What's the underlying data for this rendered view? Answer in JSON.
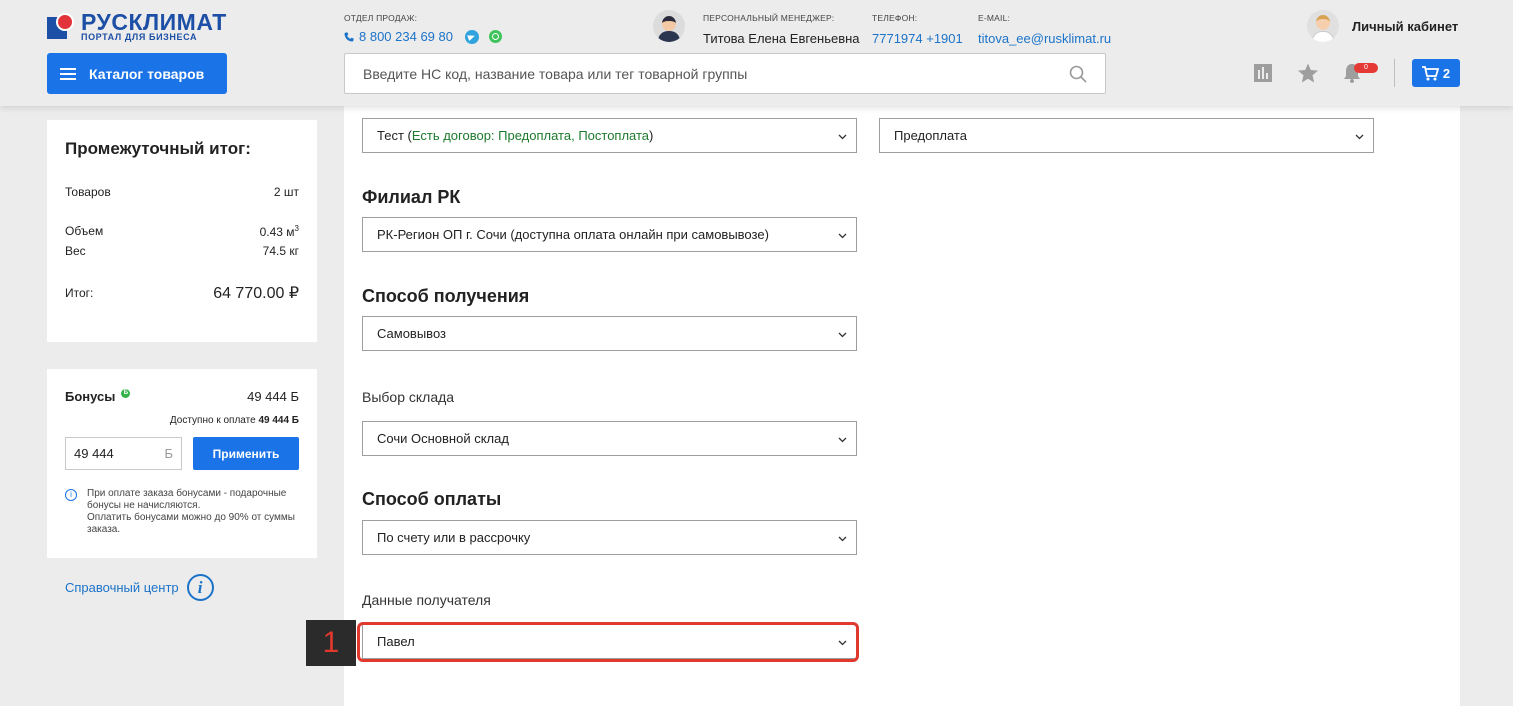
{
  "header": {
    "logo_title": "РУСКЛИМАТ",
    "logo_subtitle": "ПОРТАЛ ДЛЯ БИЗНЕСА",
    "sales_label": "ОТДЕЛ ПРОДАЖ:",
    "sales_phone": "8 800 234 69 80",
    "manager_label": "ПЕРСОНАЛЬНЫЙ МЕНЕДЖЕР:",
    "manager_name": "Титова Елена Евгеньевна",
    "phone_label": "ТЕЛЕФОН:",
    "phone_value": "7771974 +1901",
    "email_label": "E-MAIL:",
    "email_value": "titova_ee@rusklimat.ru",
    "cabinet_label": "Личный кабинет",
    "catalog_button": "Каталог товаров",
    "search_placeholder": "Введите НС код, название товара или тег товарной группы",
    "notifications_count": "0",
    "cart_count": "2"
  },
  "subtotal": {
    "title": "Промежуточный итог:",
    "goods_label": "Товаров",
    "goods_value": "2 шт",
    "volume_label": "Объем",
    "volume_value": "0.43 м",
    "volume_unit_sup": "3",
    "weight_label": "Вес",
    "weight_value": "74.5 кг",
    "total_label": "Итог:",
    "total_value": "64 770.00 ₽"
  },
  "bonus": {
    "title": "Бонусы",
    "badge": "Б",
    "value": "49 444 Б",
    "available_prefix": "Доступно к оплате ",
    "available_value": "49 444 Б",
    "input_value": "49 444",
    "input_unit": "Б",
    "apply_button": "Применить",
    "info_line1": "При оплате заказа бонусами - подарочные бонусы не начисляются.",
    "info_line2": "Оплатить бонусами можно до 90% от суммы заказа."
  },
  "help_center": "Справочный центр",
  "form": {
    "contract_select_prefix": "Тест (",
    "contract_select_green": "Есть договор: Предоплата, Постоплата",
    "contract_select_suffix": ")",
    "payment_type_select": "Предоплата",
    "branch_heading": "Филиал РК",
    "branch_select": "РК-Регион ОП г. Сочи (доступна оплата онлайн при самовывозе)",
    "delivery_heading": "Способ получения",
    "delivery_select": "Самовывоз",
    "warehouse_label": "Выбор склада",
    "warehouse_select": "Сочи Основной склад",
    "payment_heading": "Способ оплаты",
    "payment_select": "По счету или в рассрочку",
    "recipient_label": "Данные получателя",
    "recipient_select": "Павел"
  },
  "annotation_marker": "1",
  "colors": {
    "accent": "#1b73e8",
    "brand": "#1d4fa6",
    "highlight": "#e03a2f"
  }
}
